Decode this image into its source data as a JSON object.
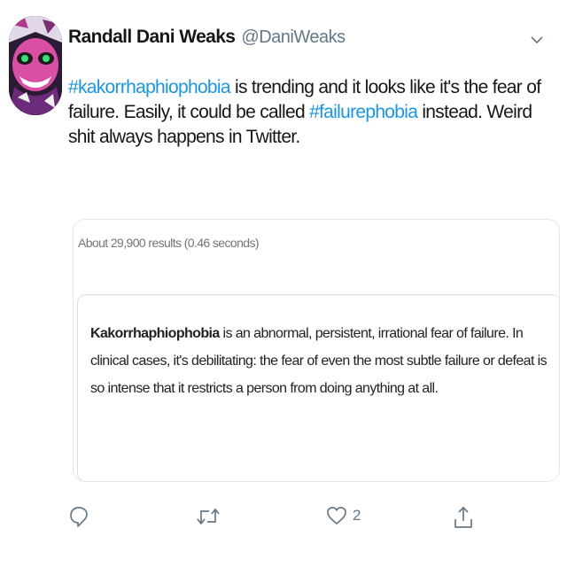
{
  "tweet": {
    "display_name": "Randall Dani Weaks",
    "handle": "@DaniWeaks",
    "text_parts": {
      "hashtag1": "#kakorrhaphiophobia",
      "text1": " is trending and it looks like it's the fear of failure. Easily, it could be called ",
      "hashtag2": "#failurephobia",
      "text2": " instead. Weird shit always happens in Twitter."
    }
  },
  "card": {
    "results_count": "About 29,900 results (0.46 seconds)",
    "snippet_term": "Kakorrhaphiophobia",
    "snippet_rest": " is an abnormal, persistent, irrational fear of failure. In clinical cases, it's debilitating: the fear of even the most subtle failure or defeat is so intense that it restricts a person from doing anything at all."
  },
  "actions": {
    "reply_icon": "reply-icon",
    "retweet_icon": "retweet-icon",
    "like_icon": "heart-icon",
    "like_count": "2",
    "share_icon": "share-icon"
  },
  "colors": {
    "hashtag": "#1b95e0",
    "muted": "#657786",
    "text": "#14171a"
  }
}
